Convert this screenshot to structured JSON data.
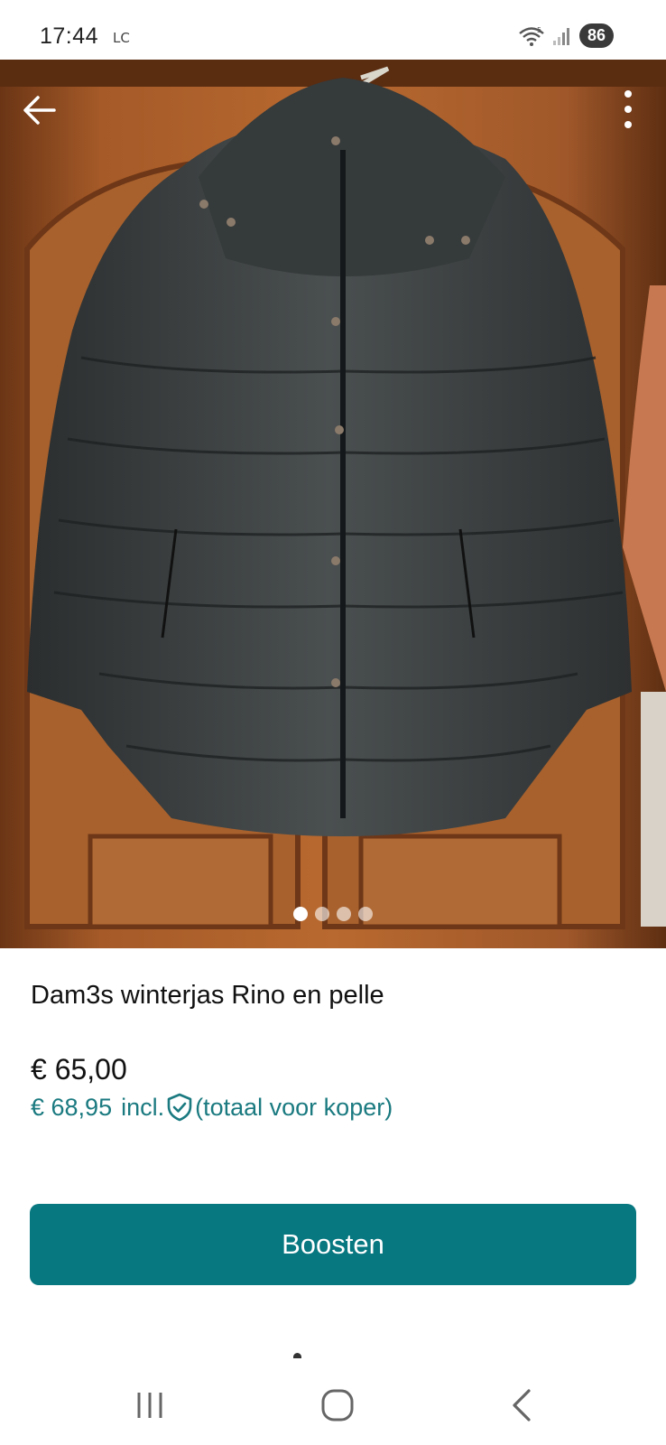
{
  "status_bar": {
    "time": "17:44",
    "carrier": "LC",
    "battery": "86",
    "icons": [
      "wifi-icon",
      "signal-icon"
    ]
  },
  "photo": {
    "icons": {
      "back": "arrow-left-icon",
      "more": "more-vertical-icon"
    },
    "image_count": 4,
    "active_image": 0
  },
  "listing": {
    "title": "Dam3s winterjas Rino en pelle",
    "price": "€ 65,00",
    "price_incl": "€ 68,95",
    "incl_label": "incl.",
    "incl_note": "(totaal voor koper)"
  },
  "actions": {
    "boost_label": "Boosten"
  },
  "colors": {
    "accent": "#077780",
    "accent_text": "#1a7a80"
  },
  "nav_bar": {
    "icons": [
      "recent-apps-icon",
      "home-icon",
      "back-nav-icon"
    ]
  }
}
